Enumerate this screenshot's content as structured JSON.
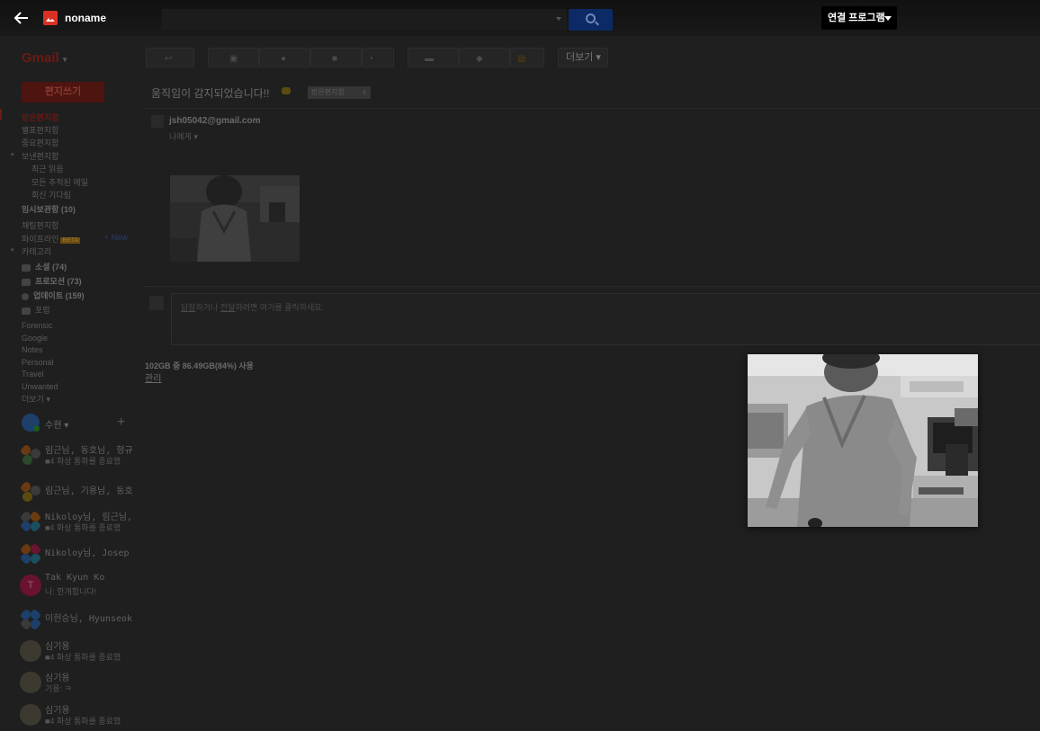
{
  "viewer": {
    "file_name": "noname",
    "open_with_label": "연결 프로그램"
  },
  "gmail": {
    "logo": "Gmail",
    "toolbar": {
      "more_label": "더보기"
    },
    "compose_label": "편지쓰기",
    "nav": [
      {
        "label": "받은편지함",
        "state": "active"
      },
      {
        "label": "별표편지함"
      },
      {
        "label": "중요편지함"
      },
      {
        "label": "보낸편지함",
        "expanded": true
      },
      {
        "label": "최근 읽음",
        "sub": true
      },
      {
        "label": "모든 추적된 메일",
        "sub": true
      },
      {
        "label": "회신 기다림",
        "sub": true
      },
      {
        "label": "임시보관함 (10)",
        "bold": true
      },
      {
        "label": "채팅편지함"
      },
      {
        "label": "파이프라인"
      },
      {
        "label": "카테고리",
        "expanded": true
      },
      {
        "label": "소셜 (74)",
        "bold": true,
        "icon": "people-icon"
      },
      {
        "label": "프로모션 (73)",
        "bold": true,
        "icon": "tag-icon"
      },
      {
        "label": "업데이트 (159)",
        "bold": true,
        "icon": "info-icon"
      },
      {
        "label": "포럼",
        "icon": "forum-icon"
      },
      {
        "label": "Forensic"
      },
      {
        "label": "Google"
      },
      {
        "label": "Notes"
      },
      {
        "label": "Personal"
      },
      {
        "label": "Travel"
      },
      {
        "label": "Unwanted"
      },
      {
        "label": "더보기 ▾"
      }
    ],
    "pipeline_badge": "BETA",
    "new_label": "+ New",
    "hangouts_user": "수현",
    "chats": [
      {
        "name": "림근님, 동호님, 형규",
        "status": "■4 화상 통화를 종료했"
      },
      {
        "name": "림근님, 기용님, 동호",
        "status": ""
      },
      {
        "name": "Nikoloy님, 림근님,",
        "status": "■4 화상 통화를 종료했"
      },
      {
        "name": "Nikoloy님, Josep",
        "status": ""
      },
      {
        "name": "Tak Kyun Ko",
        "status": "나: 한개합니다!",
        "initial": "T"
      },
      {
        "name": "이현승님, Hyunseok",
        "status": ""
      },
      {
        "name": "심기용",
        "status": "■4 화상 통화를 종료했"
      },
      {
        "name": "심기용",
        "status": "기용: ㅋ"
      },
      {
        "name": "심기용",
        "status": "■4 화상 통화를 종료했"
      }
    ],
    "message": {
      "subject": "움직임이 감지되었습니다!!",
      "label_chip": "받은편지함",
      "sender": "jsh05042@gmail.com",
      "to": "나에게",
      "reply_hint_pre": "답장",
      "reply_hint_mid": "하거나 ",
      "reply_hint_link": "전달",
      "reply_hint_post": "하려면 여기를 클릭하세요."
    },
    "storage": "102GB 중 86.49GB(84%) 사용",
    "manage_label": "관리"
  },
  "colors": {
    "viewer_bg": "#1f1f1f",
    "file_icon": "#d93025",
    "open_with_bg": "#000000"
  }
}
